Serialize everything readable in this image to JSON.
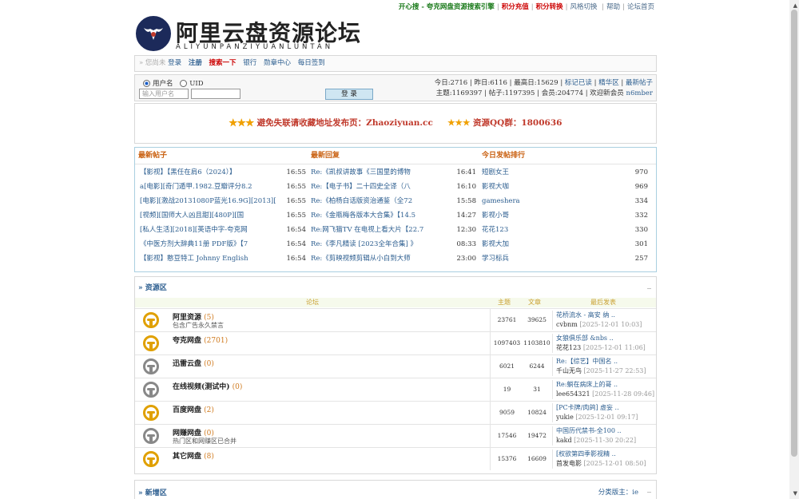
{
  "toplinks": [
    "开心搜 - 夸克网盘资源搜索引擎",
    "积分充值",
    "积分转换",
    "风格切换 ",
    "帮助",
    "论坛首页"
  ],
  "logo": {
    "title": "阿里云盘资源论坛",
    "subtitle": "ALIYUNPANZIYUANLUNTAN"
  },
  "nav": {
    "prefix": "» 您尚未",
    "items": [
      "登录",
      "注册",
      "搜索一下",
      "银行",
      "勋章中心",
      "每日签到"
    ]
  },
  "login": {
    "radio1": "用户名",
    "radio2": "UID",
    "username_placeholder": "输入用户名",
    "button": "登 录",
    "stats_line1_a": "今日:2716 | 昨日:6116 | 最高日:15629 | ",
    "stats_line1_links": [
      "标记已读",
      "精华区",
      "最新帖子"
    ],
    "stats_line2": "主题:1169397 | 帖子:1197395 | 会员:204774 | 欢迎新会员 ",
    "new_member": "n6mber"
  },
  "announce": {
    "text1": "避免失联请收藏地址发布页：Zhaoziyuan.cc",
    "text2": "资源QQ群：1800636"
  },
  "latest": {
    "headers": [
      "最新帖子",
      "最新回复",
      "今日发帖排行"
    ],
    "posts": [
      {
        "t": "【影视】【黑任在肩6（2024）】",
        "tm": "16:55"
      },
      {
        "t": "a[电影][奇门遁甲.1982.豆瓣评分8.2",
        "tm": "16:55"
      },
      {
        "t": "[电影][激战20131080P蓝光16.9G][2013][",
        "tm": "16:55"
      },
      {
        "t": "[视频][国师大人凶且甜][480P][国",
        "tm": "16:55"
      },
      {
        "t": "[私人生活][2018][英语中字-夸克网",
        "tm": "16:54"
      },
      {
        "t": "《中医方剂大辞典11册 PDF版》【7",
        "tm": "16:54"
      },
      {
        "t": "【影视】憨豆特工 Johnny English",
        "tm": "16:54"
      }
    ],
    "replies": [
      {
        "t": "Re:《凯叔讲故事《三国里的博物",
        "tm": "16:41"
      },
      {
        "t": "Re:【电子书】二十四史全译（八",
        "tm": "16:10"
      },
      {
        "t": "Re:《柏杨白话版资治通鉴（全72",
        "tm": "15:58"
      },
      {
        "t": "Re:《金瓶梅各版本大合集》【14.5",
        "tm": "14:27"
      },
      {
        "t": "Re:网飞猫TV 在电视上看大片【22.7",
        "tm": "12:30"
      },
      {
        "t": "Re:《李凡精读 [2023全年合集] 》",
        "tm": "08:33"
      },
      {
        "t": "Re:《剪映视频剪辑从小白到大师",
        "tm": "23:00"
      }
    ],
    "ranking": [
      {
        "t": "短剧女王",
        "tm": "970"
      },
      {
        "t": "影视大咖",
        "tm": "969"
      },
      {
        "t": "gameshera",
        "tm": "334"
      },
      {
        "t": "影视小哥",
        "tm": "332"
      },
      {
        "t": "花花123",
        "tm": "330"
      },
      {
        "t": "影视大加",
        "tm": "301"
      },
      {
        "t": "学习标兵",
        "tm": "257"
      }
    ]
  },
  "resource": {
    "title": "» 资源区",
    "collapse": "_",
    "headers": {
      "forum": "论坛",
      "threads": "主题",
      "posts": "文章",
      "last": "最后发表"
    },
    "forums": [
      {
        "name": "阿里资源",
        "count": "(5)",
        "desc": "包含广告永久禁言",
        "threads": "23761",
        "posts": "39625",
        "last_title": "花桥流水 - 高安 纳 ..",
        "last_user": "cvbnm",
        "last_date": "[2025-12-01 10:03]",
        "color": "gold"
      },
      {
        "name": "夸克网盘",
        "count": "(2701)",
        "desc": "",
        "threads": "1097403",
        "posts": "1103810",
        "last_title": "女狼俱乐部 &nbs ..",
        "last_user": "花花123",
        "last_date": "[2025-12-01 11:06]",
        "color": "gold"
      },
      {
        "name": "迅雷云盘",
        "count": "(0)",
        "desc": "",
        "threads": "6021",
        "posts": "6244",
        "last_title": "Re:【综艺】中国名 ..",
        "last_user": "千山无鸟",
        "last_date": "[2025-11-27 22:53]",
        "color": "gray"
      },
      {
        "name": "在线视频(测试中)",
        "count": "(0)",
        "desc": "",
        "threads": "19",
        "posts": "31",
        "last_title": "Re:躺在病床上的哥 ..",
        "last_user": "lee654321",
        "last_date": "[2025-11-28 09:46]",
        "color": "gray"
      },
      {
        "name": "百度网盘",
        "count": "(2)",
        "desc": "",
        "threads": "9059",
        "posts": "10824",
        "last_title": "[PC卡牌/肉鸽] 虚妄 ..",
        "last_user": "yukie",
        "last_date": "[2025-12-01 09:17]",
        "color": "gold"
      },
      {
        "name": "网赚网盘",
        "count": "(0)",
        "desc": "热门区和网赚区已合并",
        "threads": "17546",
        "posts": "19472",
        "last_title": "中国历代禁书-全100 ..",
        "last_user": "kakd",
        "last_date": "[2025-11-30 20:22]",
        "color": "gray"
      },
      {
        "name": "其它网盘",
        "count": "(8)",
        "desc": "",
        "threads": "15376",
        "posts": "16609",
        "last_title": "[权欲第四季影视精 ..",
        "last_user": "首发电影",
        "last_date": "[2025-12-01 08:50]",
        "color": "gold"
      }
    ]
  },
  "newarea": {
    "title": "» 新增区",
    "mod": "分类版主：ie",
    "collapse": "_"
  }
}
